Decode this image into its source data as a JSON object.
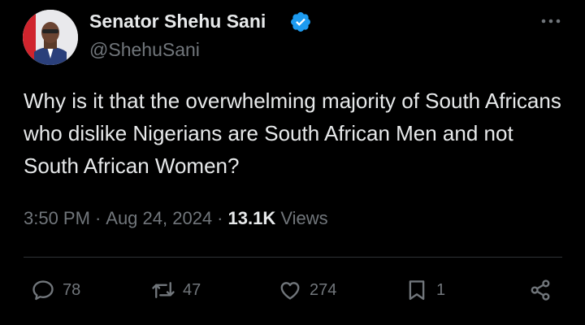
{
  "author": {
    "name": "Senator Shehu Sani",
    "handle": "@ShehuSani",
    "verified": true
  },
  "tweet": {
    "text": "Why is it that the overwhelming majority of South Africans who dislike Nigerians are South African Men and not South African Women?"
  },
  "meta": {
    "time": "3:50 PM",
    "separator": "·",
    "date": "Aug 24, 2024",
    "views_count": "13.1K",
    "views_label": "Views"
  },
  "actions": {
    "replies": "78",
    "retweets": "47",
    "likes": "274",
    "bookmarks": "1"
  },
  "icons": {
    "verified": "verified-badge-icon",
    "more": "more-horizontal-icon",
    "reply": "reply-icon",
    "retweet": "retweet-icon",
    "like": "heart-icon",
    "bookmark": "bookmark-icon",
    "share": "share-icon"
  },
  "colors": {
    "background": "#000000",
    "text_primary": "#e7e9ea",
    "text_secondary": "#71767b",
    "verified": "#1d9bf0",
    "divider": "#2f3336"
  }
}
